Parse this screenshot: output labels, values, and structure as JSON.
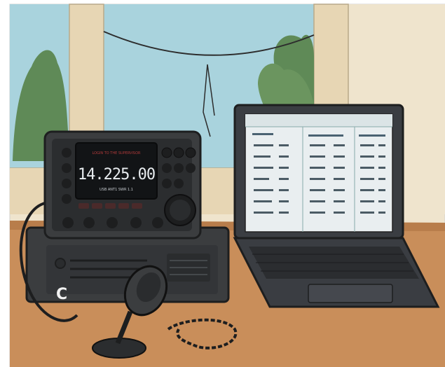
{
  "scene": {
    "description_free": true,
    "palette": {
      "sky": "#a9d3dd",
      "wall": "#efe4cd",
      "window_frame": "#e7d6b4",
      "tree": "#5f8a57",
      "desk": "#c98e5a",
      "desk_shadow": "#b87d4b",
      "radio_body": "#3b3d3f",
      "radio_face": "#2b2d2f",
      "display_bg": "#121416",
      "laptop_body": "#3a3d42",
      "laptop_screen": "#e9eef0",
      "accent_red": "#b23a3a"
    }
  },
  "radio": {
    "display": {
      "top_text": "LOGIN TO THE SUPERVISOR",
      "frequency": "14.225.00",
      "sub_text": "USB  ANT1  SWR 1.1"
    },
    "badge": "C"
  },
  "laptop": {
    "screen_header_left": "",
    "screen_header_right": ""
  }
}
